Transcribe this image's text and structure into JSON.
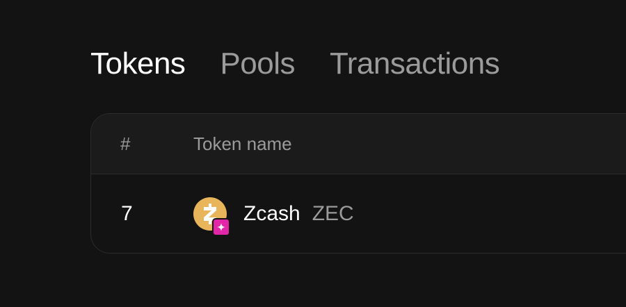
{
  "tabs": [
    {
      "label": "Tokens",
      "active": true
    },
    {
      "label": "Pools",
      "active": false
    },
    {
      "label": "Transactions",
      "active": false
    }
  ],
  "table": {
    "headers": {
      "rank": "#",
      "token_name": "Token name"
    },
    "rows": [
      {
        "rank": "7",
        "name": "Zcash",
        "symbol": "ZEC",
        "logo_icon": "zcash-logo-icon",
        "chain_badge_icon": "sparkle-icon"
      }
    ]
  },
  "colors": {
    "background": "#131313",
    "header_background": "#1b1b1b",
    "border": "#2c2c2c",
    "text_primary": "#ffffff",
    "text_secondary": "#9b9b9b",
    "zcash_gold": "#e8b55a",
    "badge_pink": "#e126a8"
  }
}
